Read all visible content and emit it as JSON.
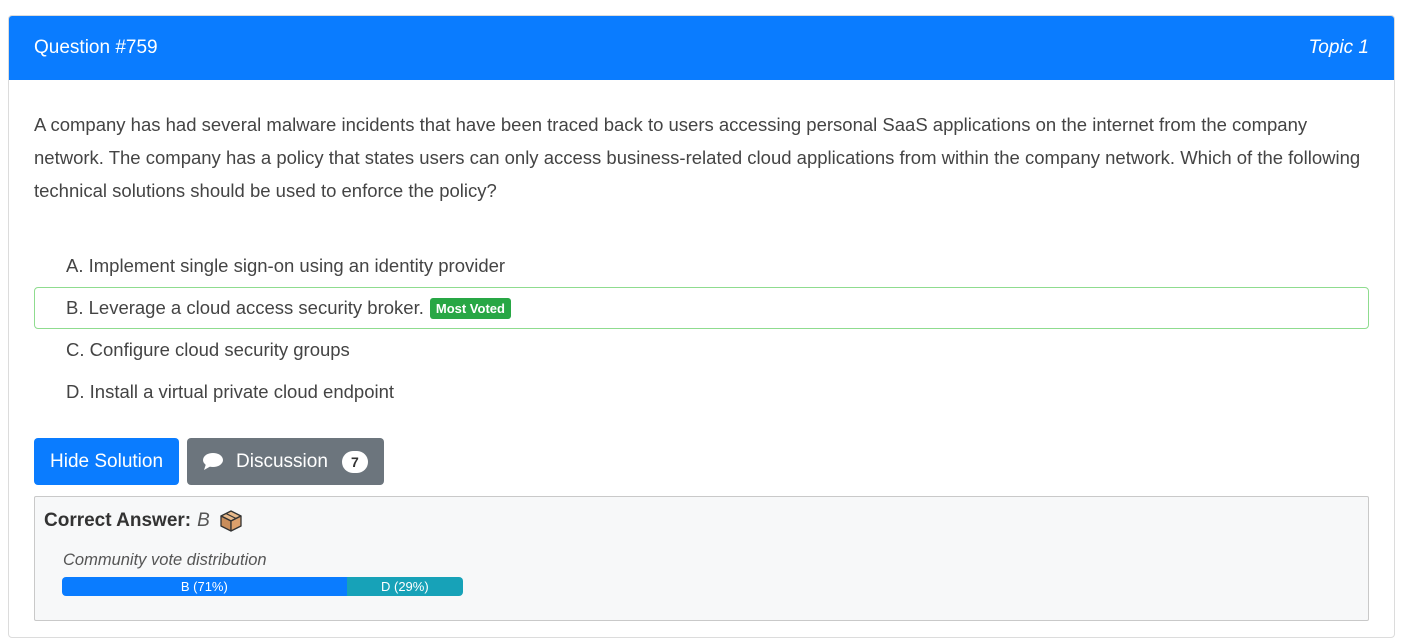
{
  "header": {
    "question_number": "Question #759",
    "topic": "Topic 1"
  },
  "question": {
    "text": "A company has had several malware incidents that have been traced back to users accessing personal SaaS applications on the internet from the company network. The company has a policy that states users can only access business-related cloud applications from within the company network. Which of the following technical solutions should be used to enforce the policy?"
  },
  "choices": [
    {
      "text": "A. Implement single sign-on using an identity provider"
    },
    {
      "text": "B. Leverage a cloud access security broker.",
      "badge": "Most Voted"
    },
    {
      "text": "C. Configure cloud security groups"
    },
    {
      "text": "D. Install a virtual private cloud endpoint"
    }
  ],
  "actions": {
    "hide_solution_label": "Hide Solution",
    "discussion_label": "Discussion",
    "discussion_count": "7"
  },
  "answer": {
    "label": "Correct Answer:",
    "value": "B",
    "icon": "box-icon"
  },
  "votes": {
    "title": "Community vote distribution",
    "segments": [
      {
        "label": "B (71%)",
        "percent": 71,
        "color": "#0a7cff"
      },
      {
        "label": "D (29%)",
        "percent": 29,
        "color": "#17a2b8"
      }
    ]
  },
  "colors": {
    "header_bg": "#0a7cff",
    "badge_bg": "#28a745",
    "discussion_bg": "#6c757d"
  }
}
